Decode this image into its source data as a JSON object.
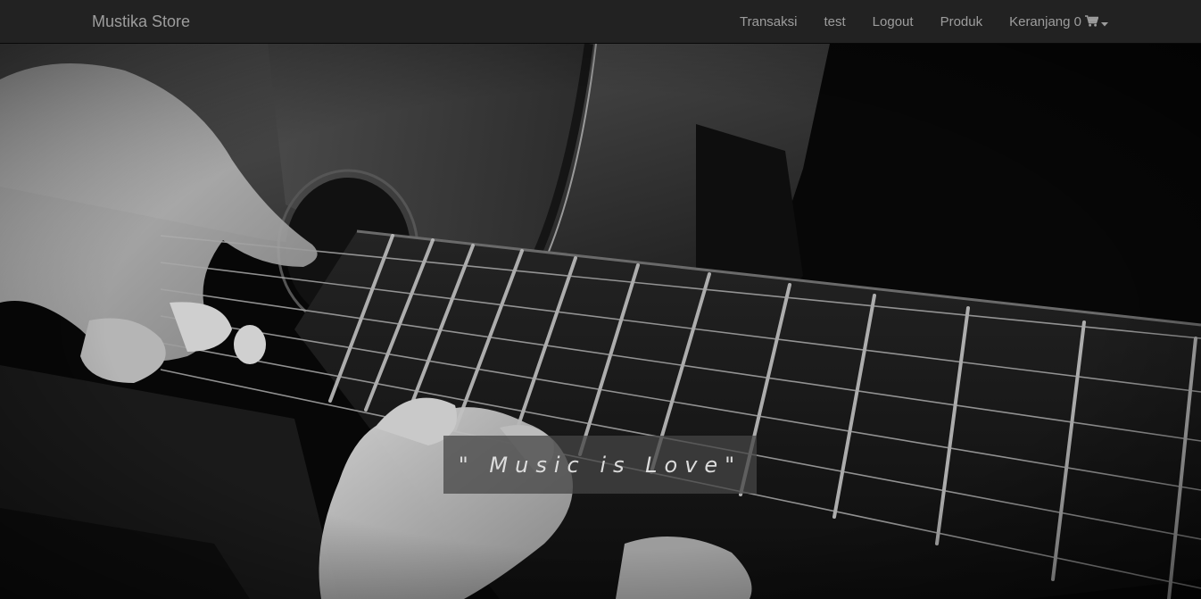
{
  "navbar": {
    "brand": "Mustika Store",
    "items": [
      {
        "label": "Transaksi"
      },
      {
        "label": "test"
      },
      {
        "label": "Logout"
      },
      {
        "label": "Produk"
      },
      {
        "label": "Keranjang 0",
        "icon": "shopping-cart-icon",
        "dropdown": true
      }
    ]
  },
  "hero": {
    "background": "guitar-playing-photo",
    "quote": "\" Music is Love\""
  },
  "colors": {
    "navbar_bg": "#222222",
    "nav_text": "#9d9d9d",
    "quote_bg": "#464646",
    "quote_text": "#dcdcdc"
  }
}
